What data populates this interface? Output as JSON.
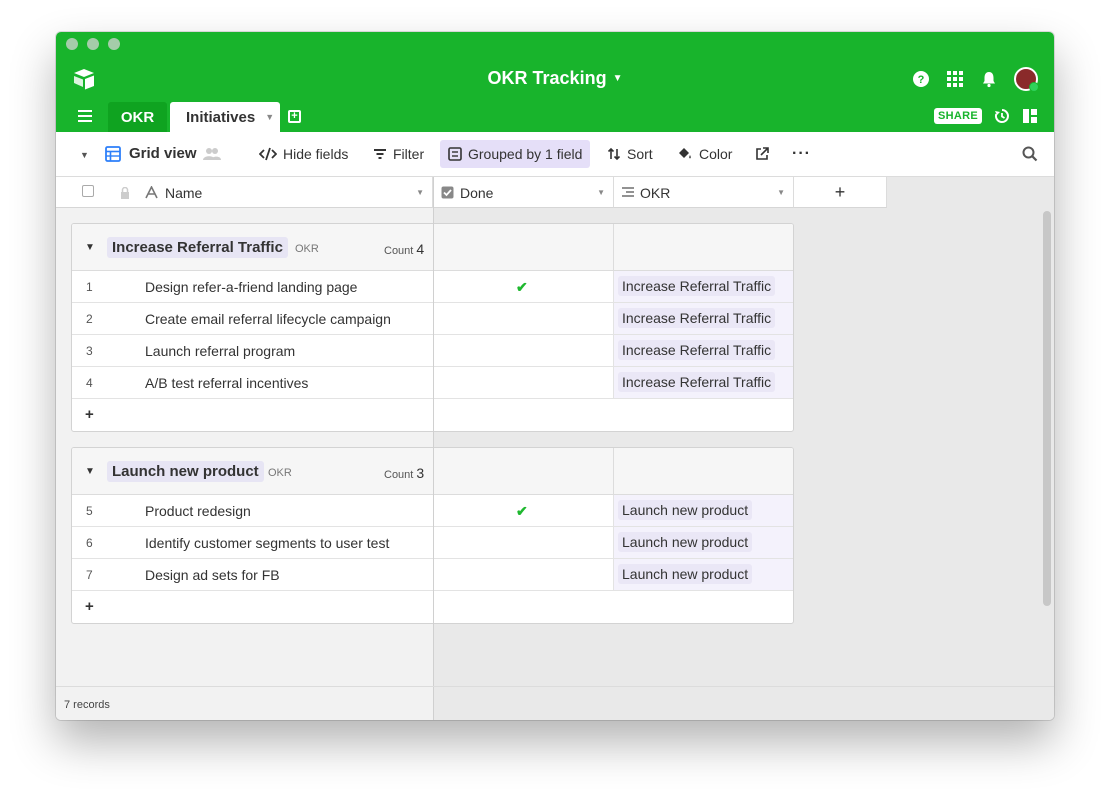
{
  "app": {
    "title": "OKR Tracking",
    "share_label": "SHARE"
  },
  "tabs": [
    {
      "label": "OKR"
    },
    {
      "label": "Initiatives"
    }
  ],
  "toolbar": {
    "view_name": "Grid view",
    "hide_fields": "Hide fields",
    "filter": "Filter",
    "grouped": "Grouped by 1 field",
    "sort": "Sort",
    "color": "Color"
  },
  "columns": {
    "name": "Name",
    "done": "Done",
    "okr": "OKR",
    "add": "+"
  },
  "groups": [
    {
      "title": "Increase Referral Traffic",
      "field": "OKR",
      "count_label": "Count",
      "count": "4",
      "rows": [
        {
          "num": "1",
          "name": "Design refer-a-friend landing page",
          "done": "✔",
          "okr": "Increase Referral Traffic"
        },
        {
          "num": "2",
          "name": "Create email referral lifecycle campaign",
          "done": "",
          "okr": "Increase Referral Traffic"
        },
        {
          "num": "3",
          "name": "Launch referral program",
          "done": "",
          "okr": "Increase Referral Traffic"
        },
        {
          "num": "4",
          "name": "A/B test referral incentives",
          "done": "",
          "okr": "Increase Referral Traffic"
        }
      ],
      "add_label": "+"
    },
    {
      "title": "Launch new product",
      "field": "OKR",
      "count_label": "Count",
      "count": "3",
      "rows": [
        {
          "num": "5",
          "name": "Product redesign",
          "done": "✔",
          "okr": "Launch new product"
        },
        {
          "num": "6",
          "name": "Identify customer segments to user test",
          "done": "",
          "okr": "Launch new product"
        },
        {
          "num": "7",
          "name": "Design ad sets for FB",
          "done": "",
          "okr": "Launch new product"
        }
      ],
      "add_label": "+"
    }
  ],
  "footer": {
    "records": "7 records"
  },
  "colors": {
    "brand": "#18b42c",
    "tab_active_bg": "#0fa320",
    "group_tag": "#e7e5f4",
    "grouped_btn": "#e5dff8",
    "check": "#1fb82f"
  }
}
